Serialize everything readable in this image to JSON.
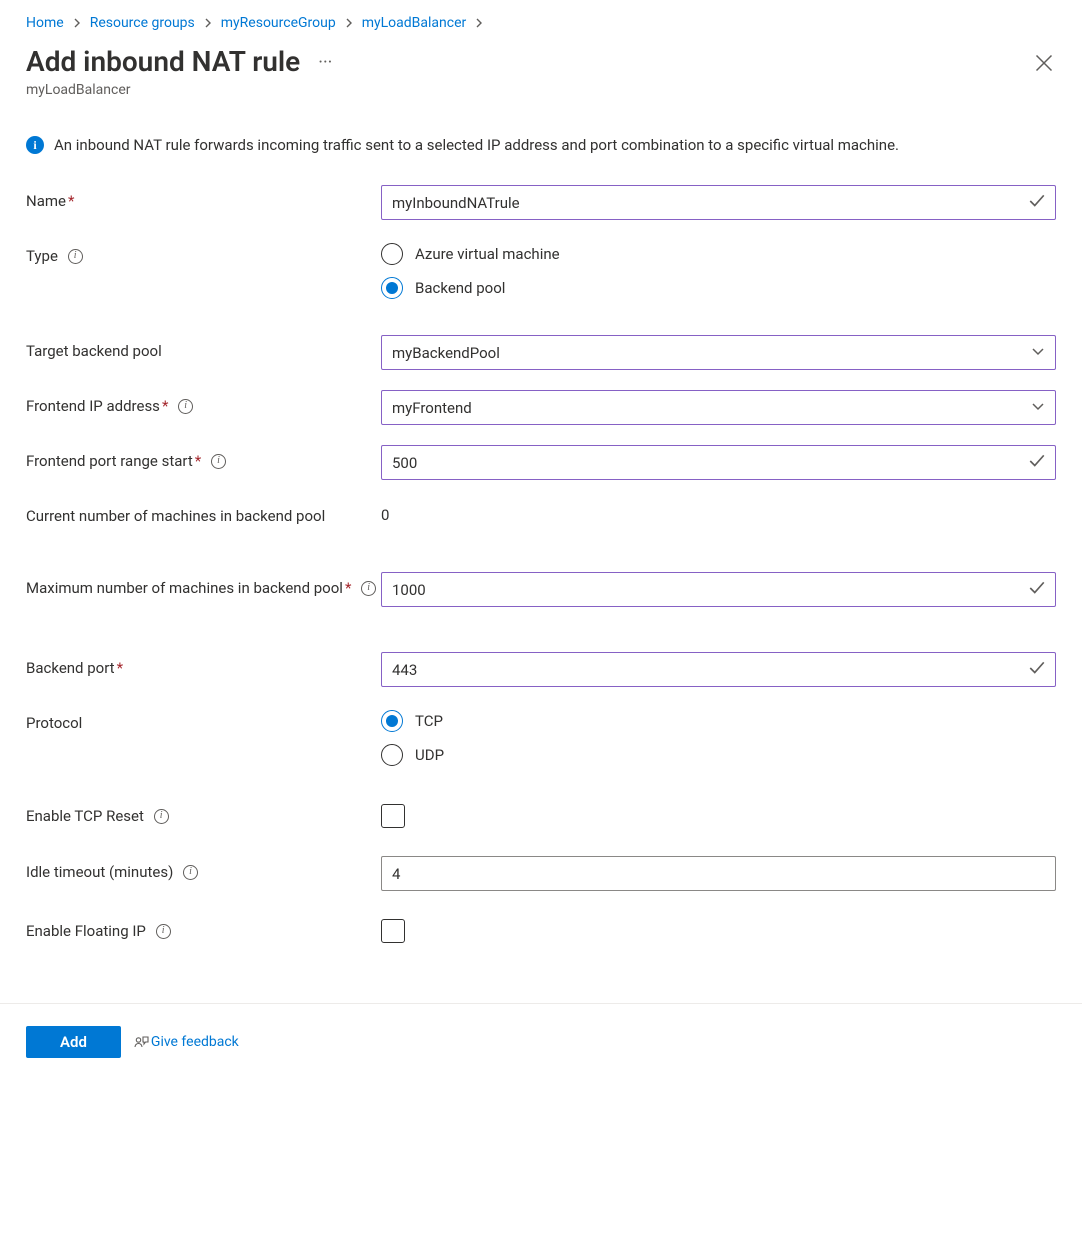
{
  "breadcrumb": {
    "items": [
      {
        "label": "Home"
      },
      {
        "label": "Resource groups"
      },
      {
        "label": "myResourceGroup"
      },
      {
        "label": "myLoadBalancer"
      }
    ]
  },
  "header": {
    "title": "Add inbound NAT rule",
    "subtitle": "myLoadBalancer"
  },
  "info": {
    "text": "An inbound NAT rule forwards incoming traffic sent to a selected IP address and port combination to a specific virtual machine."
  },
  "form": {
    "name": {
      "label": "Name",
      "value": "myInboundNATrule",
      "required": true
    },
    "type": {
      "label": "Type",
      "options": {
        "avm": "Azure virtual machine",
        "pool": "Backend pool"
      },
      "selected": "pool"
    },
    "target_pool": {
      "label": "Target backend pool",
      "value": "myBackendPool"
    },
    "frontend_ip": {
      "label": "Frontend IP address",
      "value": "myFrontend",
      "required": true
    },
    "frontend_port_start": {
      "label": "Frontend port range start",
      "value": "500",
      "required": true
    },
    "current_machines": {
      "label": "Current number of machines in backend pool",
      "value": "0"
    },
    "max_machines": {
      "label": "Maximum number of machines in backend pool",
      "value": "1000",
      "required": true
    },
    "backend_port": {
      "label": "Backend port",
      "value": "443",
      "required": true
    },
    "protocol": {
      "label": "Protocol",
      "options": {
        "tcp": "TCP",
        "udp": "UDP"
      },
      "selected": "tcp"
    },
    "tcp_reset": {
      "label": "Enable TCP Reset"
    },
    "idle_timeout": {
      "label": "Idle timeout (minutes)",
      "value": "4"
    },
    "floating_ip": {
      "label": "Enable Floating IP"
    }
  },
  "footer": {
    "add": "Add",
    "feedback": "Give feedback"
  }
}
